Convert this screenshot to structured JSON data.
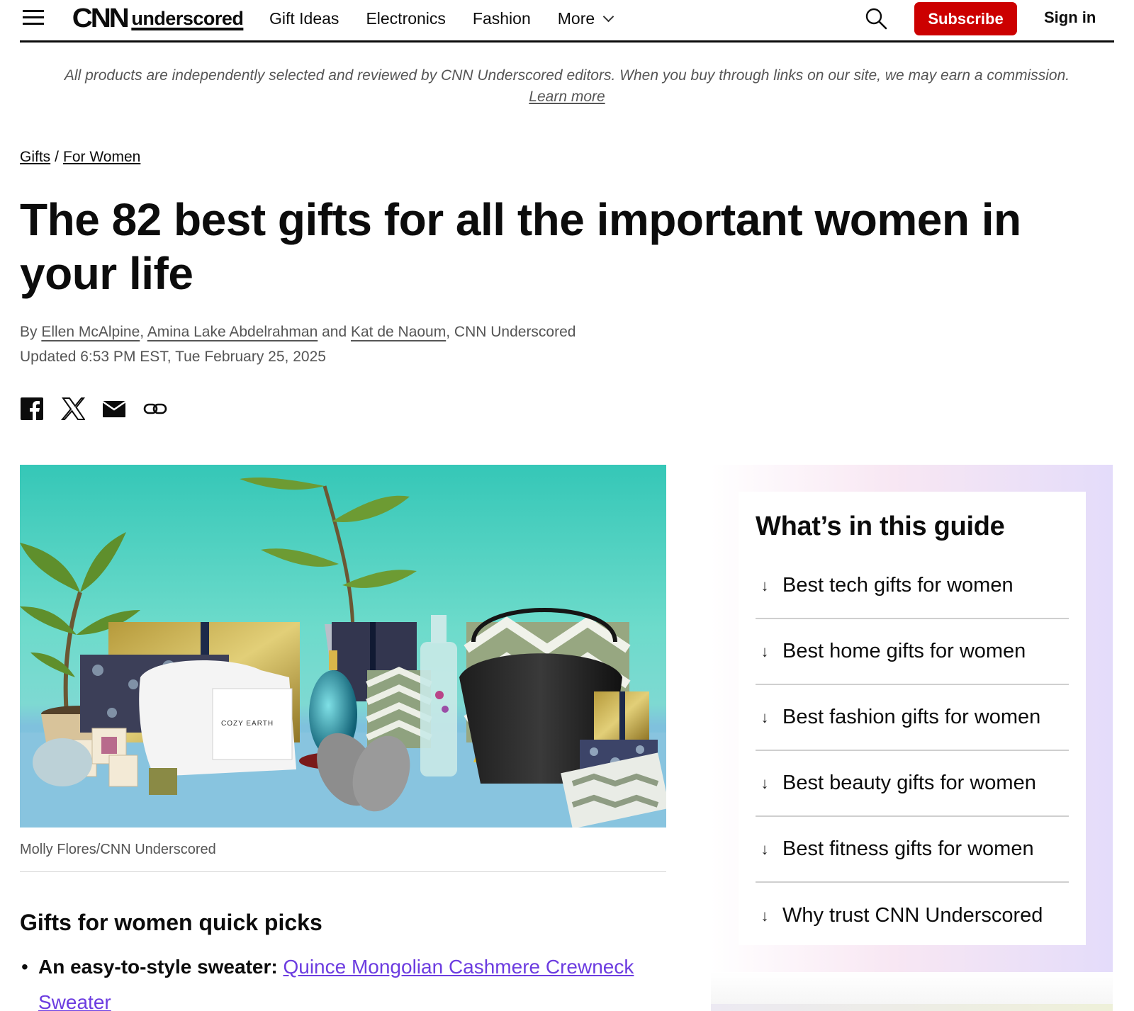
{
  "header": {
    "logo_mark": "CNN",
    "logo_text": "underscored",
    "nav": [
      {
        "label": "Gift Ideas"
      },
      {
        "label": "Electronics"
      },
      {
        "label": "Fashion"
      },
      {
        "label": "More"
      }
    ],
    "subscribe_label": "Subscribe",
    "signin_label": "Sign in",
    "accent_color": "#cc0000"
  },
  "disclaimer": {
    "text": "All products are independently selected and reviewed by CNN Underscored editors. When you buy through links on our site, we may earn a commission. ",
    "link": "Learn more"
  },
  "breadcrumb": {
    "items": [
      "Gifts",
      "For Women"
    ],
    "separator": "/"
  },
  "article": {
    "title": "The 82 best gifts for all the important women in your life",
    "byline": {
      "prefix": "By ",
      "authors": [
        "Ellen McAlpine",
        "Amina Lake Abdelrahman",
        "Kat de Naoum"
      ],
      "comma": ", ",
      "and": " and ",
      "suffix": ", CNN Underscored"
    },
    "updated": "Updated 6:53 PM EST, Tue February 25, 2025",
    "share": [
      "facebook-icon",
      "x-icon",
      "email-icon",
      "link-icon"
    ],
    "hero_image_label": "COZY EARTH",
    "caption": "Molly Flores/CNN Underscored"
  },
  "quick_picks": {
    "heading": "Gifts for women quick picks",
    "items": [
      {
        "bullet": "•",
        "lead": "An easy-to-style sweater: ",
        "link": "Quince Mongolian Cashmere Crewneck Sweater"
      }
    ],
    "link_color": "#6c3ce0"
  },
  "guide": {
    "heading": "What’s in this guide",
    "arrow": "↓",
    "items": [
      {
        "label": "Best tech gifts for women"
      },
      {
        "label": "Best home gifts for women"
      },
      {
        "label": "Best fashion gifts for women"
      },
      {
        "label": "Best beauty gifts for women"
      },
      {
        "label": "Best fitness gifts for women"
      },
      {
        "label": "Why trust CNN Underscored"
      }
    ]
  }
}
